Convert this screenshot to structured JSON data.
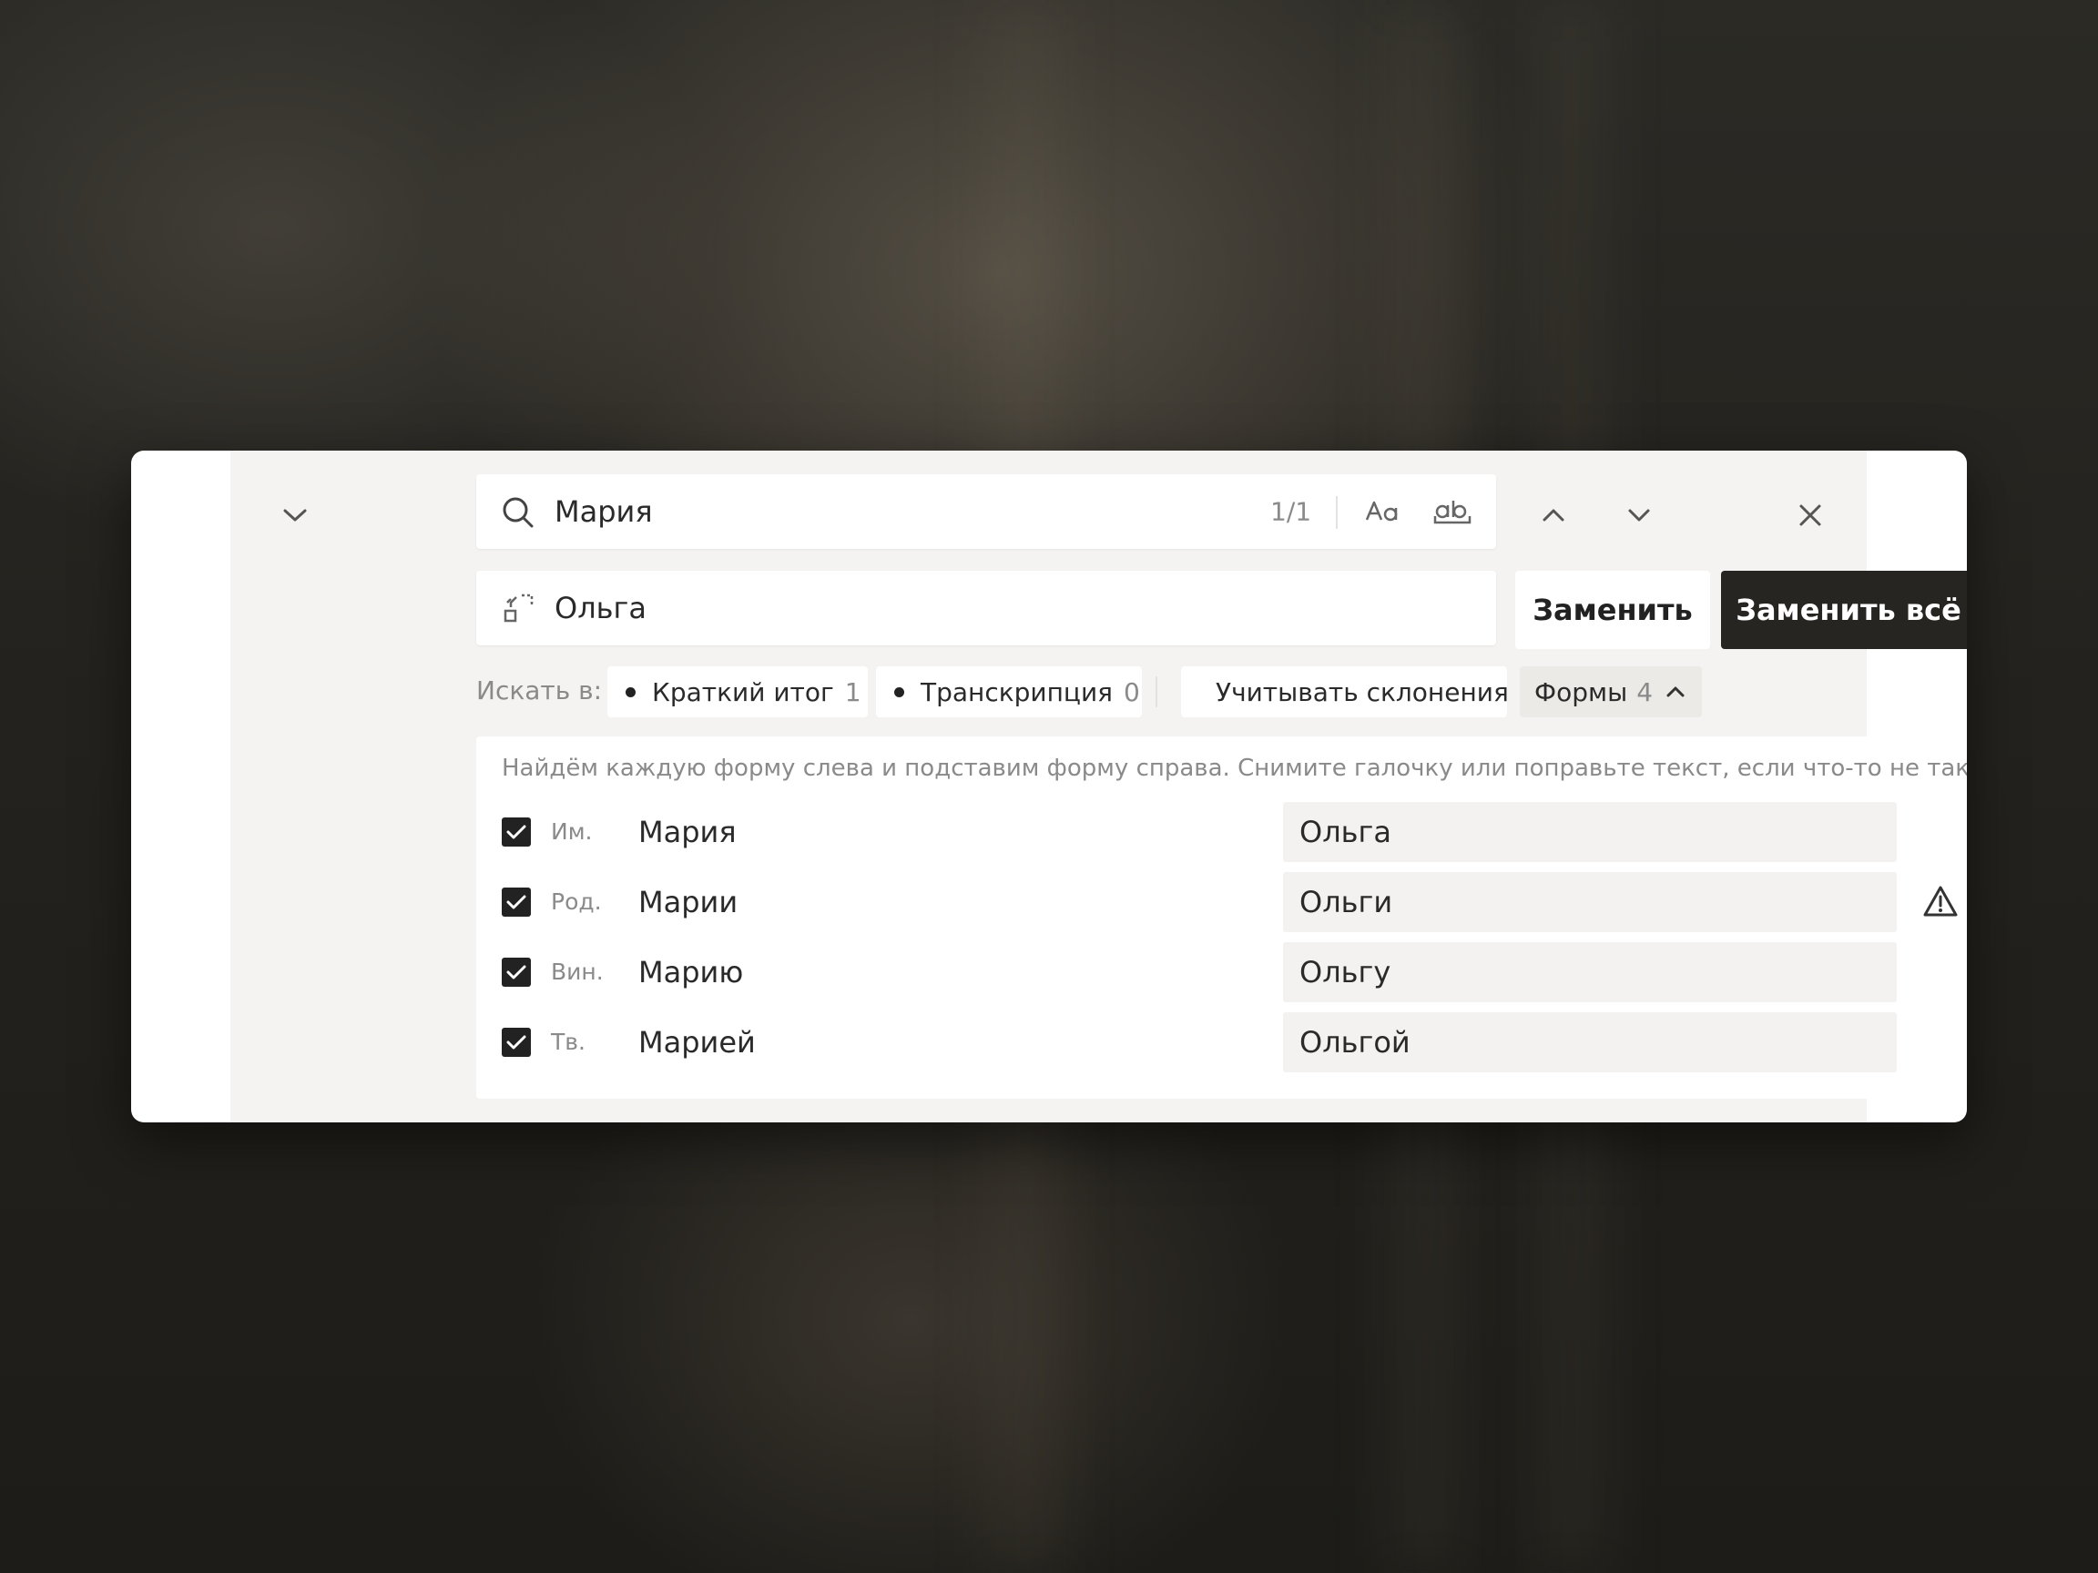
{
  "search": {
    "value": "Мария",
    "counter": "1/1"
  },
  "replace": {
    "value": "Ольга"
  },
  "buttons": {
    "replace": "Заменить",
    "replace_all": "Заменить всё"
  },
  "scope": {
    "label": "Искать в:",
    "chips": [
      {
        "label": "Краткий итог",
        "count": "1"
      },
      {
        "label": "Транскрипция",
        "count": "0"
      }
    ],
    "declension_label": "Учитывать склонения",
    "forms_label": "Формы",
    "forms_count": "4"
  },
  "forms": {
    "hint": "Найдём каждую форму слева и подставим форму справа. Снимите галочку или поправьте текст, если что-то не так.",
    "rows": [
      {
        "case": "Им.",
        "source": "Мария",
        "target": "Ольга",
        "checked": true,
        "warning": false
      },
      {
        "case": "Род.",
        "source": "Марии",
        "target": "Ольги",
        "checked": true,
        "warning": true
      },
      {
        "case": "Вин.",
        "source": "Марию",
        "target": "Ольгу",
        "checked": true,
        "warning": false
      },
      {
        "case": "Тв.",
        "source": "Марией",
        "target": "Ольгой",
        "checked": true,
        "warning": false
      }
    ]
  },
  "icons": {
    "collapse": "chevron-down-icon",
    "search": "search-icon",
    "match_case": "match-case-icon",
    "whole_word": "whole-word-icon",
    "prev": "chevron-up-icon",
    "next": "chevron-down-icon",
    "close": "close-icon",
    "replace": "replace-icon",
    "arrow": "arrow-right-icon",
    "warning": "warning-icon"
  },
  "colors": {
    "accent": "#262522",
    "panel": "#f4f3f1",
    "muted": "#8a8a8a"
  }
}
